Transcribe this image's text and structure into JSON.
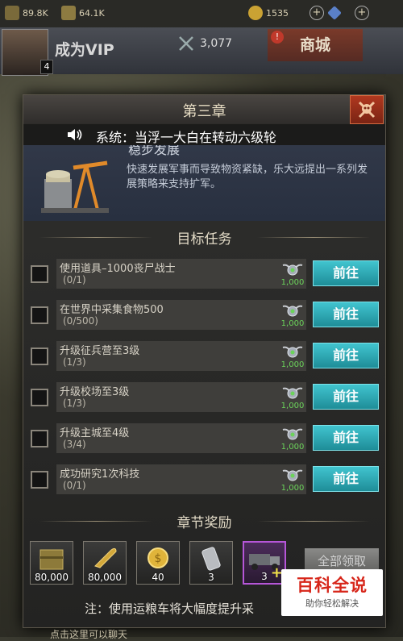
{
  "topbar": {
    "resource1": "89.8K",
    "resource2": "64.1K",
    "gold": "1535"
  },
  "header": {
    "avatar_level": "4",
    "vip_label": "成为VIP",
    "power_value": "3,077",
    "shop_label": "商城",
    "shop_badge": "!"
  },
  "modal": {
    "title": "第三章",
    "marquee": "系统：当浮一大白在转动六级轮",
    "chapter_name": "稳步发展",
    "chapter_desc": "快速发展军事而导致物资紧缺，乐大远提出一系列发展策略来支持扩军。",
    "tasks_title": "目标任务",
    "tasks": [
      {
        "name": "使用道具–1000丧尸战士",
        "progress": "(0/1)",
        "reward": "1,000",
        "button": "前往"
      },
      {
        "name": "在世界中采集食物500",
        "progress": "(0/500)",
        "reward": "1,000",
        "button": "前往"
      },
      {
        "name": "升级征兵营至3级",
        "progress": "(1/3)",
        "reward": "1,000",
        "button": "前往"
      },
      {
        "name": "升级校场至3级",
        "progress": "(1/3)",
        "reward": "1,000",
        "button": "前往"
      },
      {
        "name": "升级主城至4级",
        "progress": "(3/4)",
        "reward": "1,000",
        "button": "前往"
      },
      {
        "name": "成功研究1次科技",
        "progress": "(0/1)",
        "reward": "1,000",
        "button": "前往"
      }
    ],
    "rewards_title": "章节奖励",
    "rewards": [
      {
        "icon": "ammo-crate-icon",
        "count": "80,000"
      },
      {
        "icon": "bullet-icon",
        "count": "80,000"
      },
      {
        "icon": "gold-coin-icon",
        "count": "40"
      },
      {
        "icon": "canister-icon",
        "count": "3"
      },
      {
        "icon": "supply-truck-icon",
        "count": "3"
      }
    ],
    "claim_all": "全部领取",
    "note": "注：使用运粮车将大幅度提升采"
  },
  "watermark": {
    "title": "百科全说",
    "subtitle": "助你轻松解决"
  },
  "bottom_hint": "点击这里可以聊天",
  "colors": {
    "accent_teal": "#2aa9b4",
    "close_red": "#b0381f",
    "reward_green": "#6bd35a"
  }
}
